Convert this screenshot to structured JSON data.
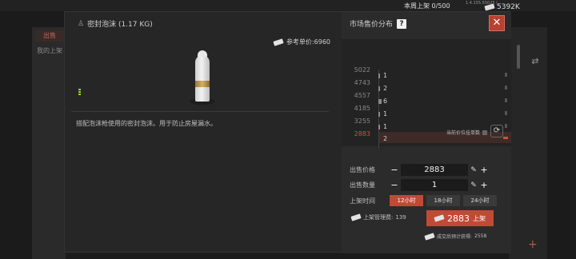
{
  "topbar": {
    "weekly_label": "本周上架",
    "weekly_count": "0/500",
    "version": "1.4.155.55025 | ...",
    "money": "5392K"
  },
  "background": {
    "left_tab": "出售",
    "left_sub": "我的上架"
  },
  "item": {
    "name": "密封泡沫 (1.17 KG)",
    "ref_price_label": "参考单价:",
    "ref_price": "6960",
    "description": "搭配泡沫枪使用的密封泡沫。用于防止房屋漏水。"
  },
  "market": {
    "title": "市场售价分布",
    "help": "?",
    "close": "✕",
    "prices": [
      "5022",
      "4743",
      "4557",
      "4185",
      "3255",
      "2883"
    ],
    "counts": [
      "1",
      "2",
      "6",
      "1",
      "1",
      "2"
    ],
    "current_option_label": "当前价位挂单数"
  },
  "form": {
    "price_label": "出售价格",
    "price_value": "2883",
    "qty_label": "出售数量",
    "qty_value": "1",
    "time_label": "上架时间",
    "time_options": [
      "12小时",
      "18小时",
      "24小时"
    ],
    "fee_label": "上架管理费:",
    "fee_value": "139",
    "list_total": "2883",
    "list_unit": "上架",
    "earn_label": "成交后预计获得:",
    "earn_value": "2558"
  },
  "colors": {
    "accent": "#c04a36",
    "current_price": "#d0503e"
  }
}
